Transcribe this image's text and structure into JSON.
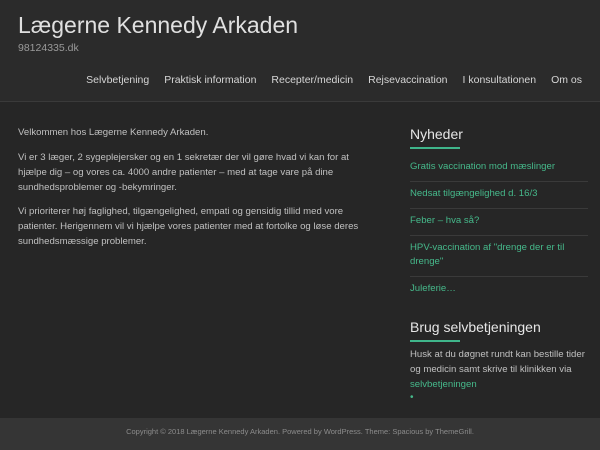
{
  "site": {
    "title": "Lægerne Kennedy Arkaden",
    "description": "98124335.dk"
  },
  "nav": {
    "items": [
      {
        "label": "Selvbetjening"
      },
      {
        "label": "Praktisk information"
      },
      {
        "label": "Recepter/medicin"
      },
      {
        "label": "Rejsevaccination"
      },
      {
        "label": "I konsultationen"
      },
      {
        "label": "Om os"
      }
    ]
  },
  "main": {
    "paragraphs": [
      "Velkommen hos Lægerne Kennedy Arkaden.",
      "Vi er 3 læger, 2 sygeplejersker og en 1 sekretær der vil gøre hvad vi kan for at hjælpe dig – og vores ca. 4000 andre patienter – med at tage vare på dine sundhedsproblemer og -bekymringer.",
      "Vi prioriterer høj faglighed, tilgængelighed, empati og gensidig tillid med vore patienter. Herigennem vil vi hjælpe vores patienter med at fortolke og løse deres sundhedsmæssige problemer."
    ]
  },
  "sidebar": {
    "news_title": "Nyheder",
    "news": [
      "Gratis vaccination mod mæslinger",
      "Nedsat tilgængelighed d. 16/3",
      "Feber – hva så?",
      "HPV-vaccination af \"drenge der er til drenge\"",
      "Juleferie…"
    ],
    "self_title": "Brug selvbetjeningen",
    "self_text": "Husk at du døgnet rundt kan bestille tider og medicin samt skrive til klinikken via ",
    "self_link": "selvbetjeningen",
    "self_bullet": "•"
  },
  "footer": {
    "prefix": "Copyright © 2018 ",
    "site_link": "Lægerne Kennedy Arkaden",
    "middle": ". Powered by ",
    "wp_link": "WordPress",
    "theme_text": ". Theme: Spacious by ",
    "theme_link": "ThemeGrill",
    "suffix": "."
  },
  "colors": {
    "accent": "#46b98b",
    "background": "#262626"
  }
}
